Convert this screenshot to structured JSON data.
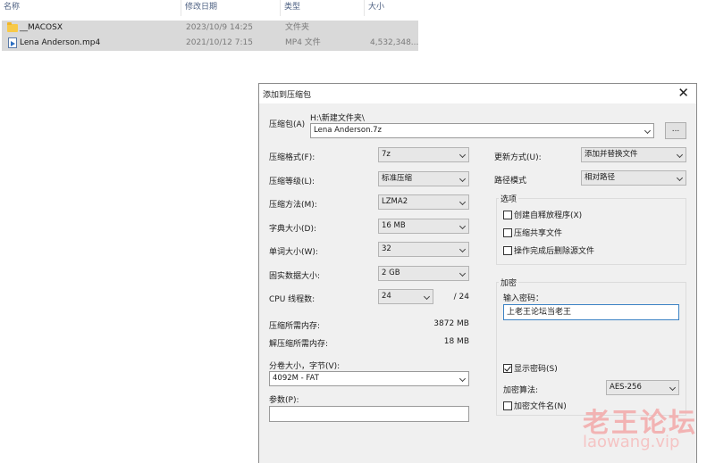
{
  "explorer": {
    "columns": [
      "名称",
      "修改日期",
      "类型",
      "大小"
    ],
    "files": [
      {
        "name": "__MACOSX",
        "date": "2023/10/9 14:25",
        "type": "文件夹",
        "size": "",
        "icon": "folder-icon"
      },
      {
        "name": "Lena Anderson.mp4",
        "date": "2021/10/12 7:15",
        "type": "MP4 文件",
        "size": "4,532,348...",
        "icon": "video-file-icon"
      }
    ]
  },
  "dialog": {
    "title": "添加到压缩包",
    "close_glyph": "✕",
    "archive_label": "压缩包(A)",
    "archive_path": "H:\\新建文件夹\\",
    "archive_name": "Lena Anderson.7z",
    "browse_label": "...",
    "format_label": "压缩格式(F):",
    "format_value": "7z",
    "level_label": "压缩等级(L):",
    "level_value": "标准压缩",
    "method_label": "压缩方法(M):",
    "method_value": "LZMA2",
    "dict_label": "字典大小(D):",
    "dict_value": "16 MB",
    "word_label": "单词大小(W):",
    "word_value": "32",
    "solid_label": "固实数据大小:",
    "solid_value": "2 GB",
    "threads_label": "CPU 线程数:",
    "threads_value": "24",
    "threads_total": "/ 24",
    "mem_compress_label": "压缩所需内存:",
    "mem_compress_value": "3872 MB",
    "mem_decompress_label": "解压缩所需内存:",
    "mem_decompress_value": "18 MB",
    "split_label": "分卷大小，字节(V):",
    "split_value": "4092M - FAT",
    "params_label": "参数(P):",
    "params_value": "",
    "update_label": "更新方式(U):",
    "update_value": "添加并替换文件",
    "pathmode_label": "路径模式",
    "pathmode_value": "相对路径",
    "options_title": "选项",
    "opt_sfx": "创建自释放程序(X)",
    "opt_shared": "压缩共享文件",
    "opt_delete": "操作完成后删除源文件",
    "encrypt_title": "加密",
    "password_label": "输入密码：",
    "password_value": "上老王论坛当老王",
    "show_password": "显示密码(S)",
    "show_password_checked": true,
    "enc_method_label": "加密算法:",
    "enc_method_value": "AES-256",
    "encrypt_names": "加密文件名(N)"
  },
  "watermark": {
    "line1": "老王论坛",
    "line2": "laowang.vip"
  }
}
